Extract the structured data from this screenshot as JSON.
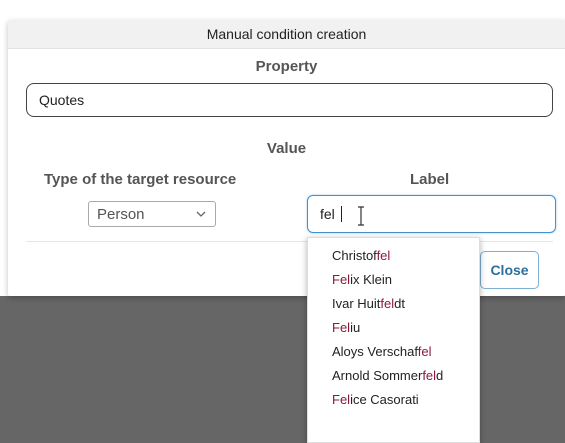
{
  "dialog": {
    "title": "Manual condition creation",
    "property_heading": "Property",
    "property_value": "Quotes",
    "value_heading": "Value",
    "type_heading": "Type of the target resource",
    "label_heading": "Label",
    "type_selected": "Person",
    "label_value": "fel",
    "close_label": "Close"
  },
  "autocomplete": {
    "items": [
      {
        "before": "Christof",
        "match": "fel",
        "after": ""
      },
      {
        "before": "",
        "match": "Fel",
        "after": "ix Klein"
      },
      {
        "before": "Ivar Huit",
        "match": "fel",
        "after": "dt"
      },
      {
        "before": "",
        "match": "Fel",
        "after": "iu"
      },
      {
        "before": "Aloys Verschaf",
        "match": "fel",
        "after": ""
      },
      {
        "before": "Arnold Sommer",
        "match": "fel",
        "after": "d"
      },
      {
        "before": "",
        "match": "Fel",
        "after": "ice Casorati"
      }
    ]
  },
  "colors": {
    "highlight": "#8b1a3a",
    "accent": "#4a90c8",
    "backdrop": "#666666"
  }
}
